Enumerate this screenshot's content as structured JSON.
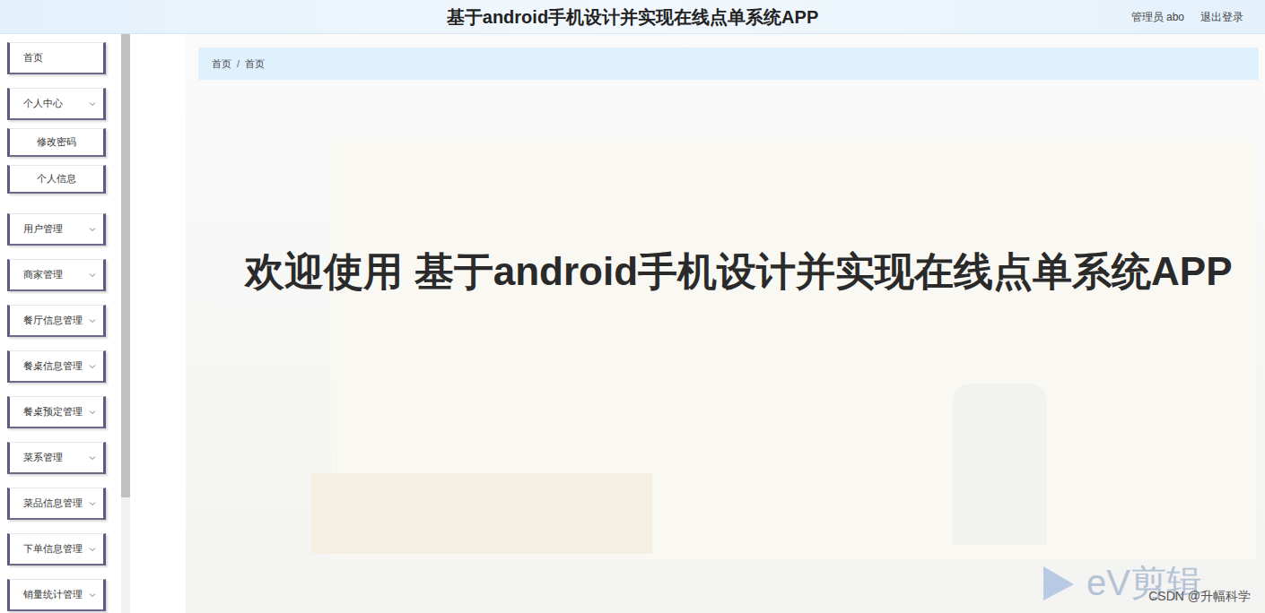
{
  "header": {
    "title": "基于android手机设计并实现在线点单系统APP",
    "user": "管理员 abo",
    "logout": "退出登录"
  },
  "sidebar": {
    "items": [
      {
        "label": "首页",
        "kind": "link"
      },
      {
        "label": "个人中心",
        "kind": "group"
      },
      {
        "label": "修改密码",
        "kind": "sub"
      },
      {
        "label": "个人信息",
        "kind": "sub"
      },
      {
        "label": "用户管理",
        "kind": "group"
      },
      {
        "label": "商家管理",
        "kind": "group"
      },
      {
        "label": "餐厅信息管理",
        "kind": "group"
      },
      {
        "label": "餐桌信息管理",
        "kind": "group"
      },
      {
        "label": "餐桌预定管理",
        "kind": "group"
      },
      {
        "label": "菜系管理",
        "kind": "group"
      },
      {
        "label": "菜品信息管理",
        "kind": "group"
      },
      {
        "label": "下单信息管理",
        "kind": "group"
      },
      {
        "label": "销量统计管理",
        "kind": "group"
      }
    ],
    "scrollbar": {
      "level": 0.8
    }
  },
  "breadcrumb": {
    "items": [
      "首页",
      "首页"
    ],
    "separator": "/"
  },
  "welcome": "欢迎使用 基于android手机设计并实现在线点单系统APP",
  "watermarks": {
    "logo": "eV剪辑",
    "credit": "CSDN @升幅科学"
  }
}
